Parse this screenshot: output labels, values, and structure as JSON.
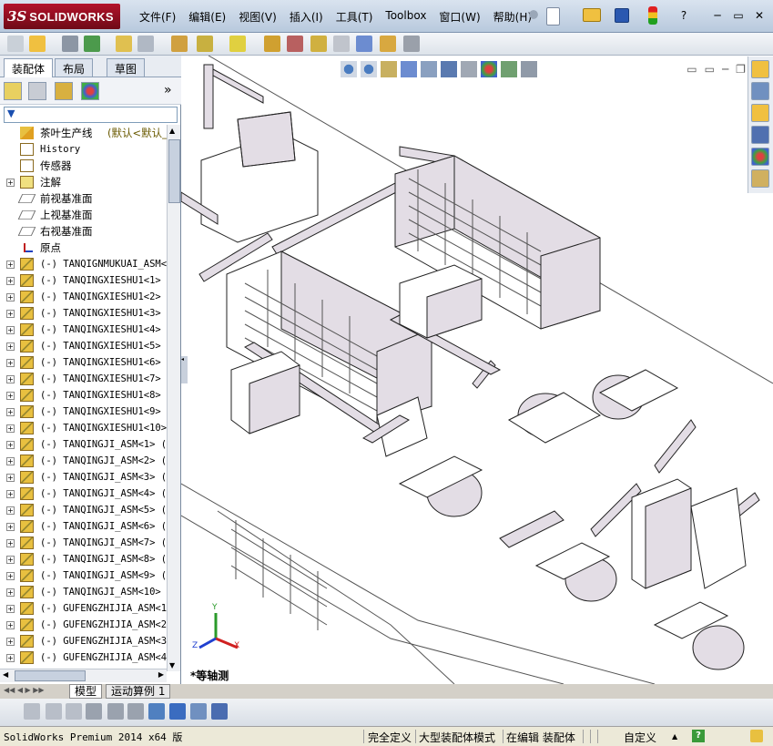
{
  "app": {
    "logo_ds": "3S",
    "logo_text": "SOLIDWORKS"
  },
  "menu": [
    "文件(F)",
    "编辑(E)",
    "视图(V)",
    "插入(I)",
    "工具(T)",
    "Toolbox",
    "窗口(W)",
    "帮助(H)"
  ],
  "window_controls": [
    "?",
    "─",
    "▭",
    "✕"
  ],
  "left_panel": {
    "tabs": [
      "装配体",
      "布局",
      "草图"
    ],
    "expand_label": "»",
    "tree": [
      {
        "label": "茶叶生产线",
        "suffix": "(默认<默认_显",
        "cn": true,
        "exp": "",
        "icon": "assembly-warning-icon"
      },
      {
        "label": "History",
        "cn": false,
        "exp": "",
        "icon": "history-icon"
      },
      {
        "label": "传感器",
        "cn": true,
        "exp": "",
        "icon": "sensor-icon"
      },
      {
        "label": "注解",
        "cn": true,
        "exp": "+",
        "icon": "annotation-icon"
      },
      {
        "label": "前视基准面",
        "cn": true,
        "exp": "",
        "icon": "plane-icon"
      },
      {
        "label": "上视基准面",
        "cn": true,
        "exp": "",
        "icon": "plane-icon"
      },
      {
        "label": "右视基准面",
        "cn": true,
        "exp": "",
        "icon": "plane-icon"
      },
      {
        "label": "原点",
        "cn": true,
        "exp": "",
        "icon": "origin-icon"
      },
      {
        "label": "(-) TANQIGNMUKUAI_ASM<1",
        "exp": "+",
        "icon": "subassembly-icon"
      },
      {
        "label": "(-) TANQINGXIESHU1<1> (",
        "exp": "+",
        "icon": "subassembly-icon"
      },
      {
        "label": "(-) TANQINGXIESHU1<2> (",
        "exp": "+",
        "icon": "subassembly-icon"
      },
      {
        "label": "(-) TANQINGXIESHU1<3> (",
        "exp": "+",
        "icon": "subassembly-icon"
      },
      {
        "label": "(-) TANQINGXIESHU1<4> (",
        "exp": "+",
        "icon": "subassembly-icon"
      },
      {
        "label": "(-) TANQINGXIESHU1<5> (",
        "exp": "+",
        "icon": "subassembly-icon"
      },
      {
        "label": "(-) TANQINGXIESHU1<6> (",
        "exp": "+",
        "icon": "subassembly-icon"
      },
      {
        "label": "(-) TANQINGXIESHU1<7> (",
        "exp": "+",
        "icon": "subassembly-icon"
      },
      {
        "label": "(-) TANQINGXIESHU1<8> (",
        "exp": "+",
        "icon": "subassembly-icon"
      },
      {
        "label": "(-) TANQINGXIESHU1<9> (",
        "exp": "+",
        "icon": "subassembly-icon"
      },
      {
        "label": "(-) TANQINGXIESHU1<10>",
        "exp": "+",
        "icon": "subassembly-icon"
      },
      {
        "label": "(-) TANQINGJI_ASM<1>  (",
        "exp": "+",
        "icon": "subassembly-icon"
      },
      {
        "label": "(-) TANQINGJI_ASM<2>  (",
        "exp": "+",
        "icon": "subassembly-icon"
      },
      {
        "label": "(-) TANQINGJI_ASM<3>  (",
        "exp": "+",
        "icon": "subassembly-icon"
      },
      {
        "label": "(-) TANQINGJI_ASM<4>  (",
        "exp": "+",
        "icon": "subassembly-icon"
      },
      {
        "label": "(-) TANQINGJI_ASM<5>  (",
        "exp": "+",
        "icon": "subassembly-icon"
      },
      {
        "label": "(-) TANQINGJI_ASM<6>  (",
        "exp": "+",
        "icon": "subassembly-icon"
      },
      {
        "label": "(-) TANQINGJI_ASM<7>  (",
        "exp": "+",
        "icon": "subassembly-icon"
      },
      {
        "label": "(-) TANQINGJI_ASM<8>  (",
        "exp": "+",
        "icon": "subassembly-icon"
      },
      {
        "label": "(-) TANQINGJI_ASM<9>  (",
        "exp": "+",
        "icon": "subassembly-icon"
      },
      {
        "label": "(-) TANQINGJI_ASM<10> (",
        "exp": "+",
        "icon": "subassembly-icon"
      },
      {
        "label": "(-) GUFENGZHIJIA_ASM<1>",
        "exp": "+",
        "icon": "subassembly-icon"
      },
      {
        "label": "(-) GUFENGZHIJIA_ASM<2>",
        "exp": "+",
        "icon": "subassembly-icon"
      },
      {
        "label": "(-) GUFENGZHIJIA_ASM<3>",
        "exp": "+",
        "icon": "subassembly-icon"
      },
      {
        "label": "(-) GUFENGZHIJIA_ASM<4>",
        "exp": "+",
        "icon": "subassembly-icon"
      }
    ]
  },
  "viewport": {
    "view_name": "*等轴测",
    "triad": {
      "x": "X",
      "y": "Y",
      "z": "Z"
    }
  },
  "bottom_tabs": [
    "模型",
    "运动算例 1"
  ],
  "status": {
    "product": "SolidWorks Premium 2014 x64 版",
    "definition": "完全定义",
    "mode": "大型装配体模式",
    "editing": "在编辑 装配体",
    "custom": "自定义",
    "custom_caret": "▲",
    "help": "?"
  },
  "colors": {
    "accent": "#b3122a",
    "panel_bg": "#ffffff",
    "chrome": "#d4d0c8",
    "model_fill": "#e3dde5"
  }
}
